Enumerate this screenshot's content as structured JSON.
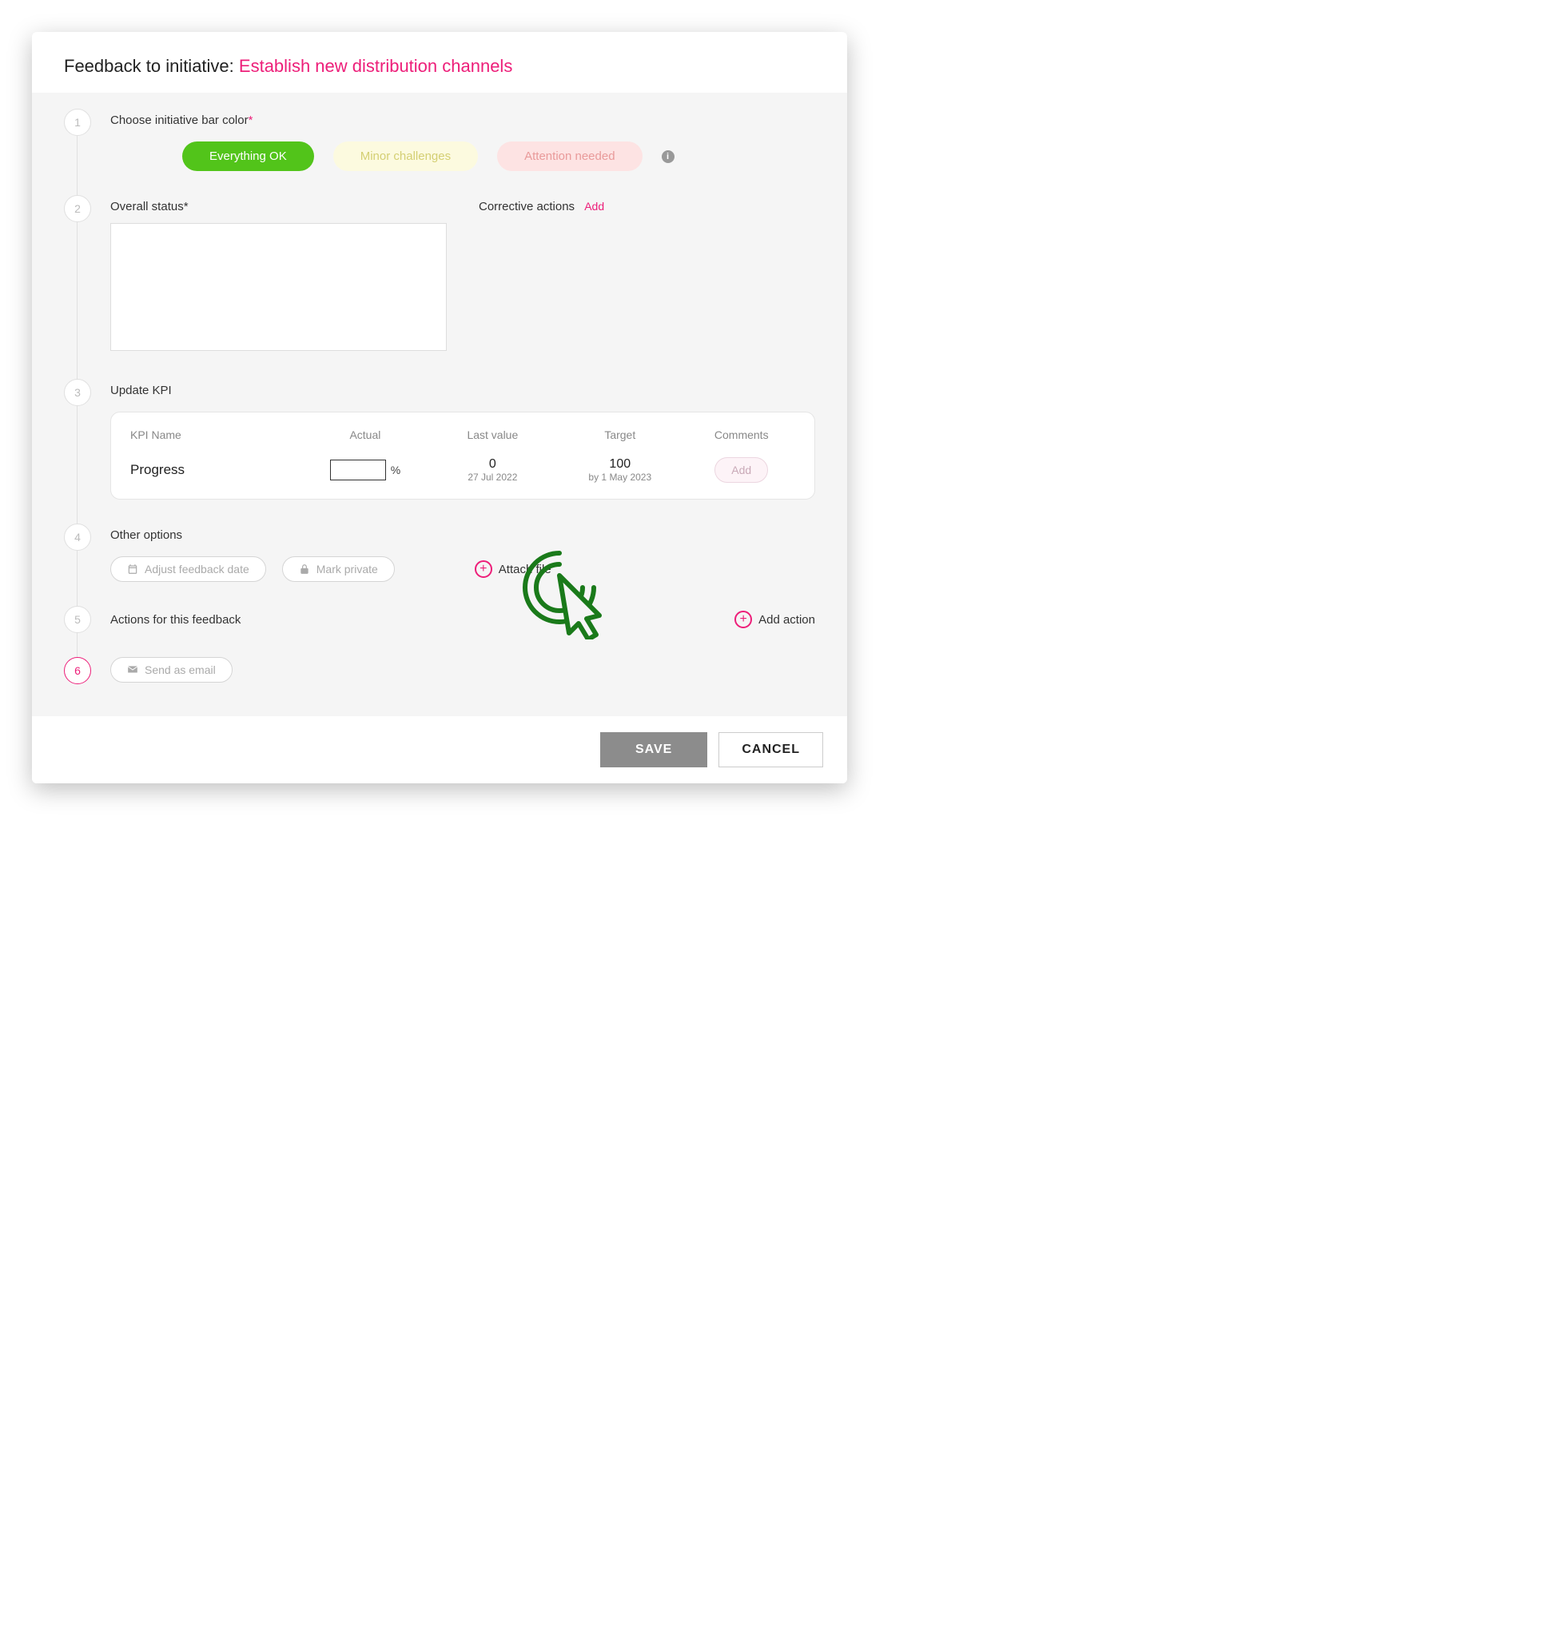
{
  "header": {
    "prefix": "Feedback to initiative:",
    "title": "Establish new distribution channels"
  },
  "steps": {
    "s1": {
      "num": "1",
      "label": "Choose initiative bar color"
    },
    "s2": {
      "num": "2",
      "label": "Overall status"
    },
    "s3": {
      "num": "3",
      "label": "Update KPI"
    },
    "s4": {
      "num": "4",
      "label": "Other options"
    },
    "s5": {
      "num": "5",
      "label": "Actions for this feedback"
    },
    "s6": {
      "num": "6"
    }
  },
  "statusPills": {
    "ok": "Everything OK",
    "minor": "Minor challenges",
    "attention": "Attention needed"
  },
  "corrective": {
    "label": "Corrective actions",
    "add": "Add"
  },
  "kpi": {
    "headers": {
      "name": "KPI Name",
      "actual": "Actual",
      "last": "Last value",
      "target": "Target",
      "comments": "Comments"
    },
    "row": {
      "name": "Progress",
      "unit": "%",
      "lastValue": "0",
      "lastDate": "27 Jul 2022",
      "targetValue": "100",
      "targetDate": "by 1 May 2023",
      "addComment": "Add"
    }
  },
  "options": {
    "adjustDate": "Adjust feedback date",
    "markPrivate": "Mark private",
    "attachFile": "Attach file"
  },
  "actions": {
    "addAction": "Add action",
    "sendEmail": "Send as email"
  },
  "footer": {
    "save": "SAVE",
    "cancel": "CANCEL"
  },
  "reqMark": "*"
}
